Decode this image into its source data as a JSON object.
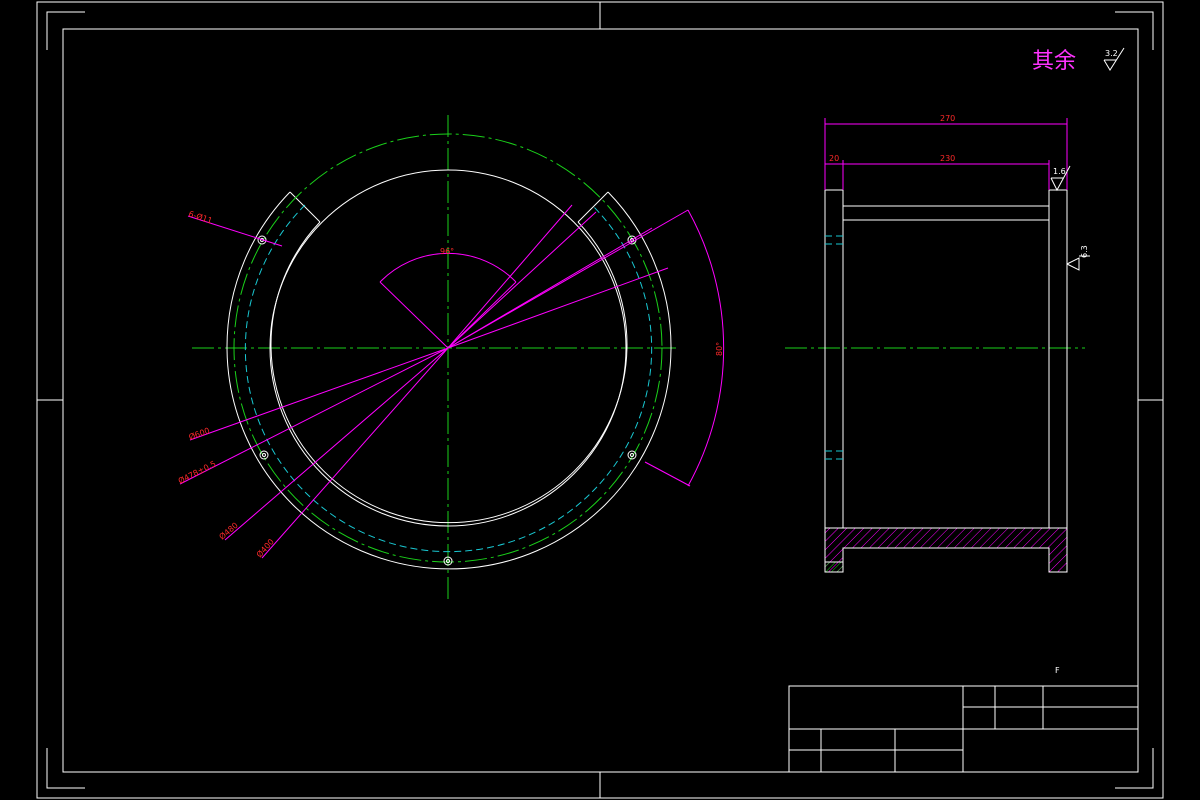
{
  "remark": {
    "text": "其余",
    "roughness": "3.2"
  },
  "front_view": {
    "angle_top": "96°",
    "angle_right": "80°",
    "labels": {
      "holes": "6-Ø11",
      "d1": "Ø600",
      "d2": "Ø478±0.5",
      "d3": "Ø480",
      "d4": "Ø400"
    }
  },
  "side_view": {
    "dim_total": "270",
    "dim_small": "20",
    "dim_inner": "230",
    "roughness_top": "1.6",
    "roughness_side": "6.3"
  },
  "note_mark": "F"
}
